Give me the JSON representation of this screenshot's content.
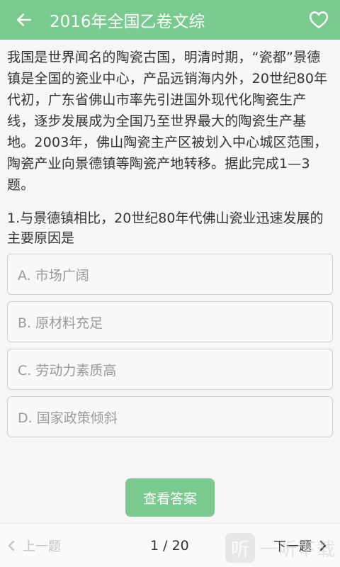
{
  "header": {
    "title": "2016年全国乙卷文综"
  },
  "passage": "我国是世界闻名的陶瓷古国，明清时期，“瓷都”景德镇是全国的瓷业中心，产品远销海内外，20世纪80年代初，广东省佛山市率先引进国外现代化陶瓷生产线，逐步发展成为全国乃至世界最大的陶瓷生产基地。2003年，佛山陶瓷主产区被划入中心城区范围，陶瓷产业向景德镇等陶瓷产地转移。据此完成1—3题。",
  "question": "1.与景德镇相比，20世纪80年代佛山瓷业迅速发展的主要原因是",
  "options": [
    {
      "label": "A. 市场广阔"
    },
    {
      "label": "B. 原材料充足"
    },
    {
      "label": "C. 劳动力素质高"
    },
    {
      "label": "D. 国家政策倾斜"
    }
  ],
  "answer_button": "查看答案",
  "footer": {
    "prev_label": "上一题",
    "page": "1 / 20",
    "next_label": "下一题"
  },
  "watermark": {
    "logo_char": "听",
    "text": "一听下载"
  },
  "colors": {
    "accent": "#7ac98f",
    "option_text": "#9a9a9a"
  },
  "icons": {
    "back": "arrow-left-icon",
    "favorite": "heart-outline-icon",
    "prev": "chevron-left-icon",
    "next": "chevron-right-icon"
  }
}
